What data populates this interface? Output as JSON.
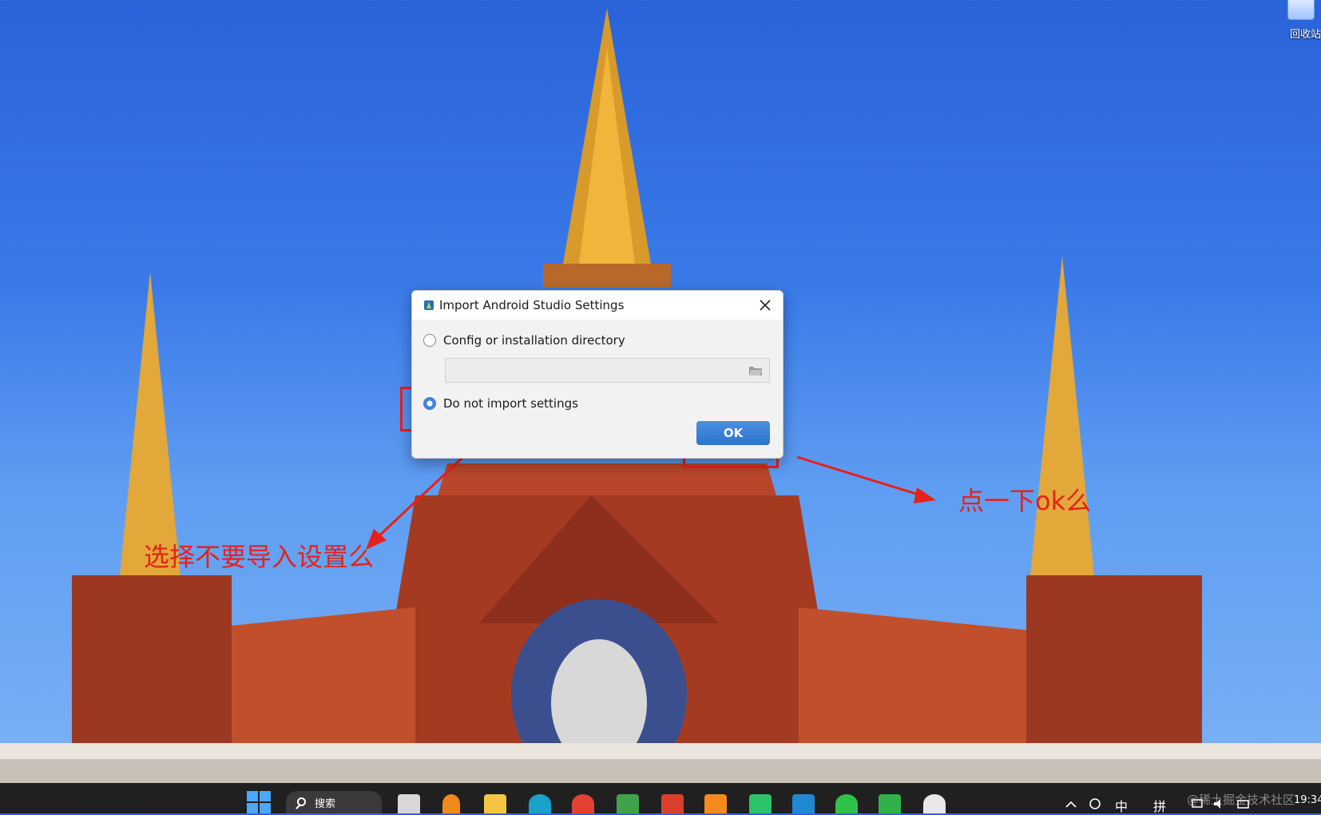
{
  "desktop": {
    "recycle_bin_label": "回收站"
  },
  "dialog": {
    "title": "Import Android Studio Settings",
    "options": [
      {
        "label": "Config or installation directory",
        "selected": false
      },
      {
        "label": "Do not import settings",
        "selected": true
      }
    ],
    "path_value": "",
    "ok_label": "OK"
  },
  "annotations": {
    "left_note": "选择不要导入设置么",
    "right_note": "点一下ok么",
    "color": "#e8201a"
  },
  "taskbar": {
    "search_label": "搜索",
    "tray": {
      "ime_mode": "中",
      "ime_pinyin": "拼",
      "time": "19:34"
    },
    "watermark": "@稀土掘金技术社区",
    "apps": [
      "file-explorer-icon",
      "magnifier-icon",
      "folder-icon",
      "edge-icon",
      "chrome-icon",
      "office-icon",
      "app-red-icon",
      "sublime-icon",
      "tick-app-icon",
      "vscode-icon",
      "wechat-icon",
      "hbuilder-icon",
      "android-studio-icon"
    ]
  }
}
